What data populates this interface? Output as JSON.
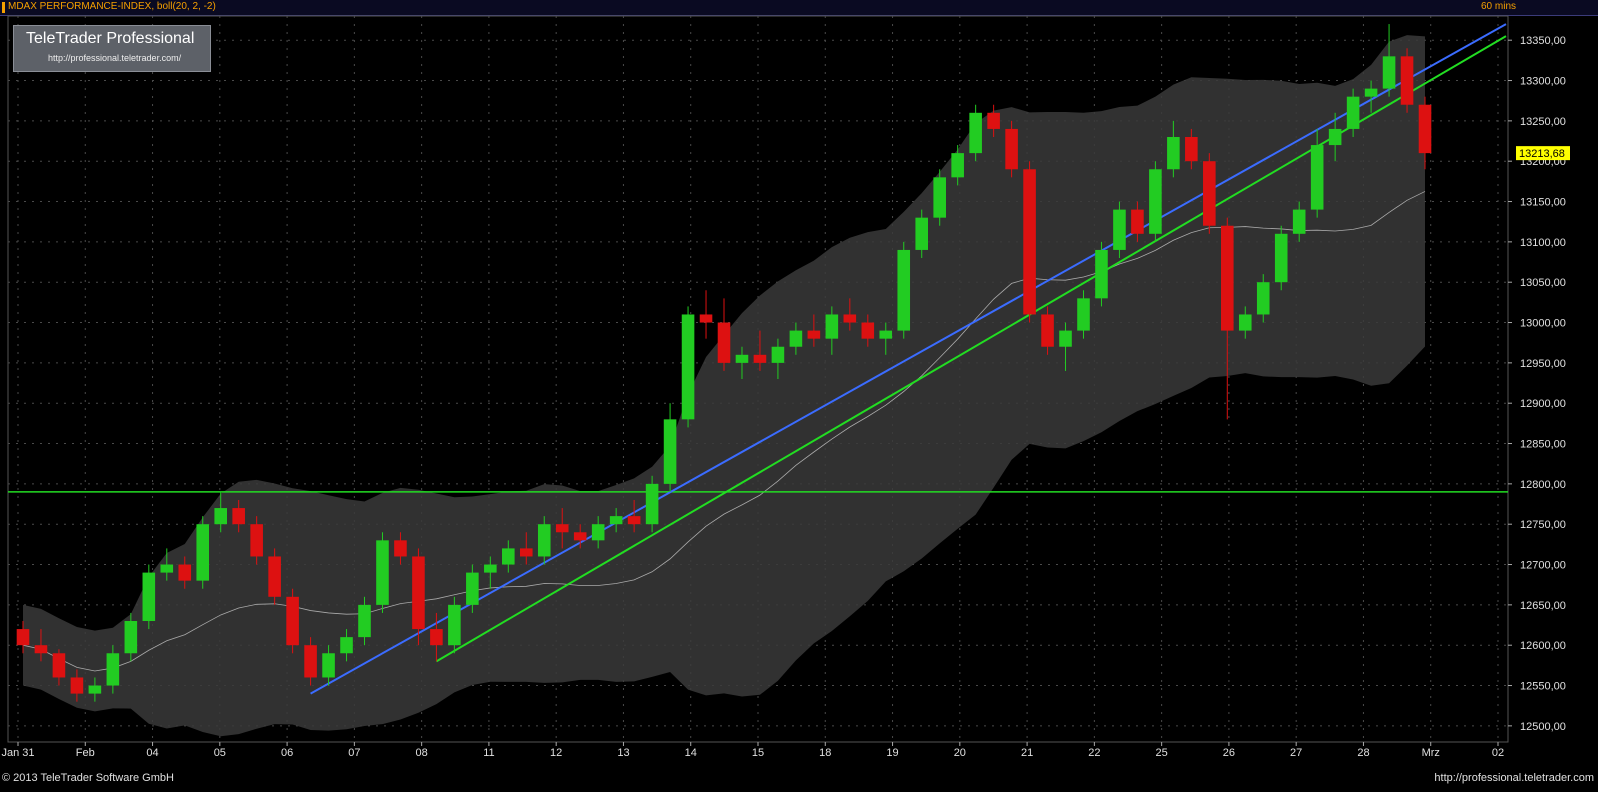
{
  "header": {
    "title": "MDAX PERFORMANCE-INDEX, boll(20, 2, -2)",
    "interval": "60 mins"
  },
  "logo": {
    "brand": "TeleTrader Professional",
    "url": "http://professional.teletrader.com/"
  },
  "footer": {
    "copyright": "© 2013 TeleTrader Software GmbH",
    "url": "http://professional.teletrader.com"
  },
  "colors": {
    "background": "#000000",
    "grid": "#4a4a4a",
    "up_candle": "#22cc22",
    "down_candle": "#dd1111",
    "band_fill": "#3a3a3a",
    "band_line": "#aaaaaa",
    "blue_trend": "#3b6cff",
    "green_trend": "#22dd22",
    "price_marker": "#ffff00"
  },
  "chart_data": {
    "type": "candlestick",
    "instrument": "MDAX PERFORMANCE-INDEX",
    "indicator": "boll(20, 2, -2)",
    "interval": "60 mins",
    "y_axis": {
      "min": 12480,
      "max": 13380,
      "ticks": [
        12500,
        12550,
        12600,
        12650,
        12700,
        12750,
        12800,
        12850,
        12900,
        12950,
        13000,
        13050,
        13100,
        13150,
        13200,
        13250,
        13300,
        13350
      ]
    },
    "x_labels": [
      "Jan 31",
      "Feb",
      "04",
      "05",
      "06",
      "07",
      "08",
      "11",
      "12",
      "13",
      "14",
      "15",
      "18",
      "19",
      "20",
      "21",
      "22",
      "25",
      "26",
      "27",
      "28",
      "Mrz",
      "02"
    ],
    "last_price": "13213,68",
    "horizontal_line": 12790,
    "trend_lines": [
      {
        "color": "blue",
        "from": {
          "bar": 0,
          "value": 12540
        },
        "to": {
          "bar": 10,
          "value": 13380
        }
      },
      {
        "color": "green",
        "from": {
          "bar": 0,
          "value": 12580
        },
        "to": {
          "bar": 10,
          "value": 13360
        }
      }
    ],
    "candles": [
      [
        12620,
        12630,
        12590,
        12600
      ],
      [
        12600,
        12620,
        12580,
        12590
      ],
      [
        12590,
        12595,
        12550,
        12560
      ],
      [
        12560,
        12570,
        12530,
        12540
      ],
      [
        12540,
        12560,
        12530,
        12550
      ],
      [
        12550,
        12600,
        12540,
        12590
      ],
      [
        12590,
        12640,
        12580,
        12630
      ],
      [
        12630,
        12700,
        12620,
        12690
      ],
      [
        12690,
        12720,
        12680,
        12700
      ],
      [
        12700,
        12710,
        12670,
        12680
      ],
      [
        12680,
        12760,
        12670,
        12750
      ],
      [
        12750,
        12790,
        12740,
        12770
      ],
      [
        12770,
        12780,
        12740,
        12750
      ],
      [
        12750,
        12760,
        12700,
        12710
      ],
      [
        12710,
        12720,
        12650,
        12660
      ],
      [
        12660,
        12670,
        12590,
        12600
      ],
      [
        12600,
        12610,
        12550,
        12560
      ],
      [
        12560,
        12600,
        12550,
        12590
      ],
      [
        12590,
        12620,
        12580,
        12610
      ],
      [
        12610,
        12660,
        12600,
        12650
      ],
      [
        12650,
        12740,
        12640,
        12730
      ],
      [
        12730,
        12740,
        12700,
        12710
      ],
      [
        12710,
        12720,
        12600,
        12620
      ],
      [
        12620,
        12640,
        12580,
        12600
      ],
      [
        12600,
        12660,
        12590,
        12650
      ],
      [
        12650,
        12700,
        12640,
        12690
      ],
      [
        12690,
        12710,
        12670,
        12700
      ],
      [
        12700,
        12730,
        12690,
        12720
      ],
      [
        12720,
        12740,
        12700,
        12710
      ],
      [
        12710,
        12760,
        12700,
        12750
      ],
      [
        12750,
        12770,
        12720,
        12740
      ],
      [
        12740,
        12750,
        12720,
        12730
      ],
      [
        12730,
        12760,
        12720,
        12750
      ],
      [
        12750,
        12770,
        12740,
        12760
      ],
      [
        12760,
        12780,
        12740,
        12750
      ],
      [
        12750,
        12810,
        12740,
        12800
      ],
      [
        12800,
        12900,
        12790,
        12880
      ],
      [
        12880,
        13020,
        12870,
        13010
      ],
      [
        13010,
        13040,
        12980,
        13000
      ],
      [
        13000,
        13030,
        12940,
        12950
      ],
      [
        12950,
        12970,
        12930,
        12960
      ],
      [
        12960,
        12990,
        12940,
        12950
      ],
      [
        12950,
        12980,
        12930,
        12970
      ],
      [
        12970,
        13000,
        12960,
        12990
      ],
      [
        12990,
        13010,
        12970,
        12980
      ],
      [
        12980,
        13020,
        12960,
        13010
      ],
      [
        13010,
        13030,
        12990,
        13000
      ],
      [
        13000,
        13010,
        12970,
        12980
      ],
      [
        12980,
        13000,
        12960,
        12990
      ],
      [
        12990,
        13100,
        12980,
        13090
      ],
      [
        13090,
        13140,
        13080,
        13130
      ],
      [
        13130,
        13190,
        13120,
        13180
      ],
      [
        13180,
        13220,
        13170,
        13210
      ],
      [
        13210,
        13270,
        13200,
        13260
      ],
      [
        13260,
        13270,
        13230,
        13240
      ],
      [
        13240,
        13250,
        13180,
        13190
      ],
      [
        13190,
        13200,
        13000,
        13010
      ],
      [
        13010,
        13020,
        12960,
        12970
      ],
      [
        12970,
        13000,
        12940,
        12990
      ],
      [
        12990,
        13040,
        12980,
        13030
      ],
      [
        13030,
        13100,
        13020,
        13090
      ],
      [
        13090,
        13150,
        13080,
        13140
      ],
      [
        13140,
        13150,
        13100,
        13110
      ],
      [
        13110,
        13200,
        13100,
        13190
      ],
      [
        13190,
        13250,
        13180,
        13230
      ],
      [
        13230,
        13240,
        13190,
        13200
      ],
      [
        13200,
        13210,
        13110,
        13120
      ],
      [
        13120,
        13130,
        12880,
        12990
      ],
      [
        12990,
        13020,
        12980,
        13010
      ],
      [
        13010,
        13060,
        13000,
        13050
      ],
      [
        13050,
        13120,
        13040,
        13110
      ],
      [
        13110,
        13150,
        13100,
        13140
      ],
      [
        13140,
        13240,
        13130,
        13220
      ],
      [
        13220,
        13260,
        13200,
        13240
      ],
      [
        13240,
        13290,
        13230,
        13280
      ],
      [
        13280,
        13300,
        13260,
        13290
      ],
      [
        13290,
        13370,
        13280,
        13330
      ],
      [
        13330,
        13340,
        13260,
        13270
      ],
      [
        13270,
        13280,
        13190,
        13210
      ]
    ]
  }
}
